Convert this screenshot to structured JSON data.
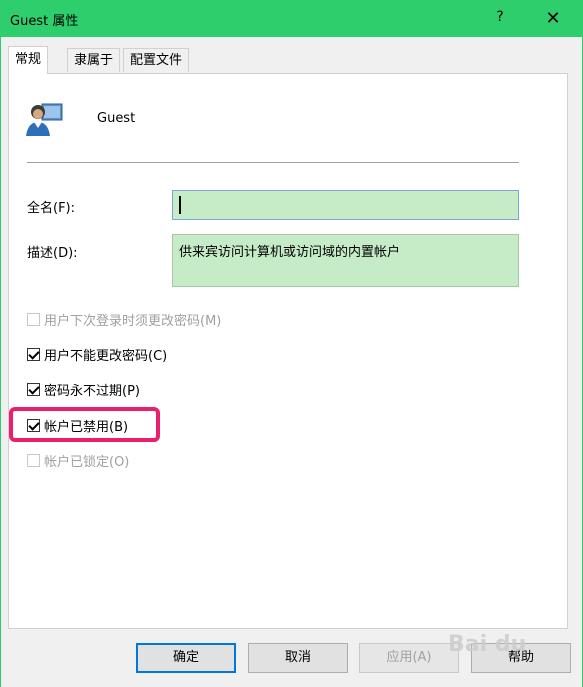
{
  "window": {
    "title": "Guest 属性",
    "help_glyph": "?",
    "close_glyph": "✕",
    "titlebar_color": "#2fce6c"
  },
  "tabs": [
    {
      "label": "常规",
      "active": true
    },
    {
      "label": "隶属于",
      "active": false
    },
    {
      "label": "配置文件",
      "active": false
    }
  ],
  "general": {
    "username": "Guest",
    "avatar_icon": "user-icon",
    "fullname_label": "全名(F):",
    "fullname_value": "",
    "description_label": "描述(D):",
    "description_value": "供来宾访问计算机或访问域的内置帐户"
  },
  "checkboxes": [
    {
      "label": "用户下次登录时须更改密码(M)",
      "checked": false,
      "enabled": false
    },
    {
      "label": "用户不能更改密码(C)",
      "checked": true,
      "enabled": true
    },
    {
      "label": "密码永不过期(P)",
      "checked": true,
      "enabled": true
    },
    {
      "label": "帐户已禁用(B)",
      "checked": true,
      "enabled": true,
      "highlighted": true
    },
    {
      "label": "帐户已锁定(O)",
      "checked": false,
      "enabled": false
    }
  ],
  "buttons": {
    "ok": "确定",
    "cancel": "取消",
    "apply": "应用(A)",
    "help": "帮助"
  },
  "highlight_color": "#ec1f6e",
  "watermark": "Bai du"
}
